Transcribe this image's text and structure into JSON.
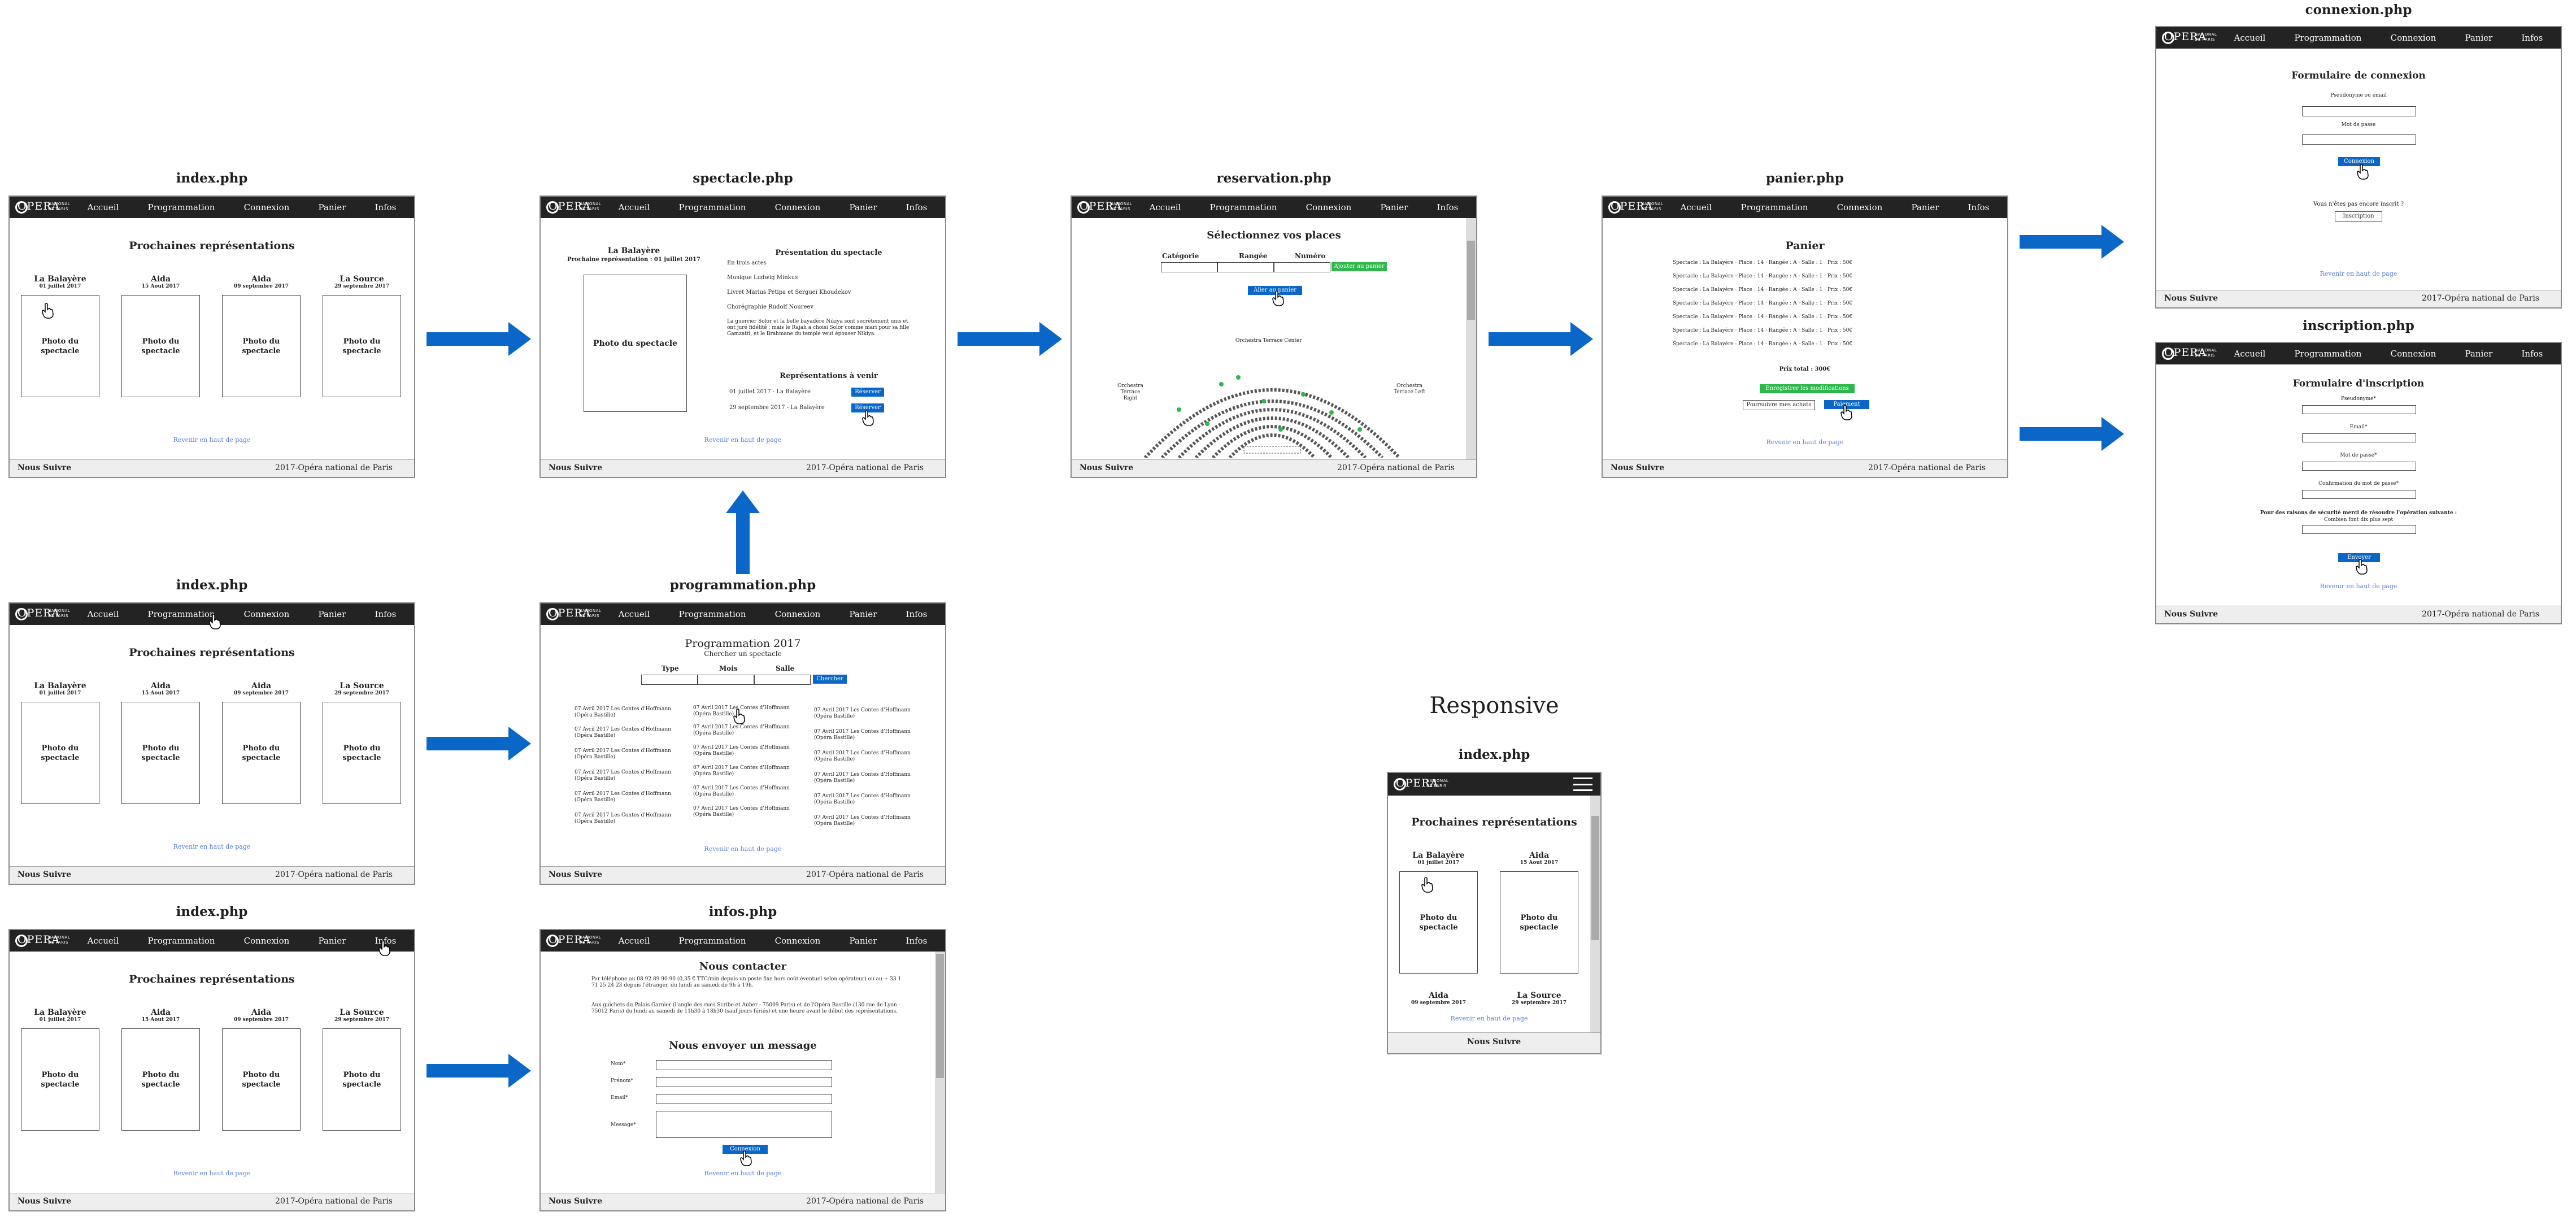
{
  "logo": {
    "big": "OPERA",
    "small_line1": "NATIONAL",
    "small_line2": "DE PARIS"
  },
  "nav": {
    "items": [
      "Accueil",
      "Programmation",
      "Connexion",
      "Panier",
      "Infos"
    ]
  },
  "footer": {
    "left": "Nous Suivre",
    "right": "2017-Opéra national de Paris"
  },
  "back_to_top": "Revenir en haut de page",
  "photo_label": "Photo du spectacle",
  "titles": {
    "index1": "index.php",
    "spectacle": "spectacle.php",
    "reservation": "reservation.php",
    "panier": "panier.php",
    "connexion": "connexion.php",
    "inscription": "inscription.php",
    "index2": "index.php",
    "programmation": "programmation.php",
    "index3": "index.php",
    "infos": "infos.php",
    "responsive": "Responsive",
    "index_mobile": "index.php"
  },
  "home": {
    "heading": "Prochaines représentations",
    "cards": [
      {
        "name": "La Balayère",
        "date": "01 juillet 2017"
      },
      {
        "name": "Aida",
        "date": "15 Aout 2017"
      },
      {
        "name": "Aida",
        "date": "09 septembre 2017"
      },
      {
        "name": "La Source",
        "date": "29 septembre 2017"
      }
    ]
  },
  "spectacle": {
    "title": "La Balayère",
    "subtitle": "Prochaine représentation : 01 juillet 2017",
    "presentation_title": "Présentation du spectacle",
    "lines": [
      "En trois actes",
      "Musique Ludwig Minkus",
      "Livret Marius Petipa et Sergueï Khoudekov",
      "Chorégraphie Rudolf Noureev"
    ],
    "paragraph": "La guerrier Solor et la belle bayadère Nikiya sont secrètement unis et ont juré fidélité ; mais le Rajah a choisi Solor comme mari pour sa fille Gamzatti, et le Brahmane du temple veut épouser Nikiya.",
    "upcoming_title": "Représentations à venir",
    "upcoming": [
      {
        "label": "01 juillet 2017 - La Balayère",
        "button": "Réserver"
      },
      {
        "label": "29 septembre 2017 - La Balayère",
        "button": "Réserver"
      }
    ]
  },
  "reservation": {
    "heading": "Sélectionnez vos places",
    "columns": [
      "Catégorie",
      "Rangée",
      "Numéro"
    ],
    "add_button": "Ajouter au panier",
    "cart_button": "Aller au panier",
    "plan_center": "Orchestra Terrace Center",
    "plan_right": "Orchestra Terrace Right",
    "plan_left": "Orchestra Terrace Left"
  },
  "panier": {
    "heading": "Panier",
    "rows": [
      "Spectacle : La Balayère · Place : 14 · Rangée : A · Salle : 1 · Prix : 50€",
      "Spectacle : La Balayère · Place : 14 · Rangée : A · Salle : 1 · Prix : 50€",
      "Spectacle : La Balayère · Place : 14 · Rangée : A · Salle : 1 · Prix : 50€",
      "Spectacle : La Balayère · Place : 14 · Rangée : A · Salle : 1 · Prix : 50€",
      "Spectacle : La Balayère · Place : 14 · Rangée : A · Salle : 1 · Prix : 50€",
      "Spectacle : La Balayère · Place : 14 · Rangée : A · Salle : 1 · Prix : 50€",
      "Spectacle : La Balayère · Place : 14 · Rangée : A · Salle : 1 · Prix : 50€"
    ],
    "total": "Prix total : 300€",
    "save_button": "Enregistrer les modifications",
    "continue_button": "Poursuivre mes achats",
    "pay_button": "Paiement"
  },
  "connexion": {
    "heading": "Formulaire de connexion",
    "label1": "Pseudonyme ou email",
    "label2": "Mot de passe",
    "submit": "Connexion",
    "not_registered": "Vous n'êtes pas encore inscrit ?",
    "register_button": "Inscription"
  },
  "inscription": {
    "heading": "Formulaire d'inscription",
    "labels": [
      "Pseudonyme*",
      "Email*",
      "Mot de passe*",
      "Confirmation du mot de passe*"
    ],
    "security": "Pour des raisons de sécurité merci de résoudre l'opération suivante :",
    "question": "Combien font dix plus sept",
    "submit": "Envoyer"
  },
  "programmation": {
    "heading": "Programmation 2017",
    "subheading": "Chercher un spectacle",
    "filters": [
      "Type",
      "Mois",
      "Salle"
    ],
    "search_button": "Chercher",
    "event_line1": "07 Avril 2017 Les Contes d'Hoffmann",
    "event_line2": "(Opéra Bastille)"
  },
  "infos": {
    "heading": "Nous contacter",
    "p1": "Par téléphone au 08 92 89 90 90 (0,35 € TTC/min depuis un poste fixe hors coût éventuel selon opérateur) ou au + 33 1 71 25 24 23 depuis l'étranger, du lundi au samedi de 9h à 19h.",
    "p2": "Aux guichets du Palais Garnier (l'angle des rues Scribe et Auber - 75009 Paris) et de l'Opéra Bastille (130 rue de Lyon - 75012 Paris) du lundi au samedi de 11h30 à 18h30 (sauf jours fériés) et une heure avant le début des représentations.",
    "form_heading": "Nous envoyer un message",
    "fields": [
      "Nom*",
      "Prénom*",
      "Email*",
      "Message*"
    ],
    "submit": "Connexion"
  },
  "mobile": {
    "cards": [
      {
        "name": "La Balayère",
        "date": "01 juillet 2017"
      },
      {
        "name": "Aida",
        "date": "15 Aout 2017"
      }
    ],
    "cards_bottom": [
      {
        "name": "Aida",
        "date": "09 septembre 2017"
      },
      {
        "name": "La Source",
        "date": "29 septembre 2017"
      }
    ]
  }
}
